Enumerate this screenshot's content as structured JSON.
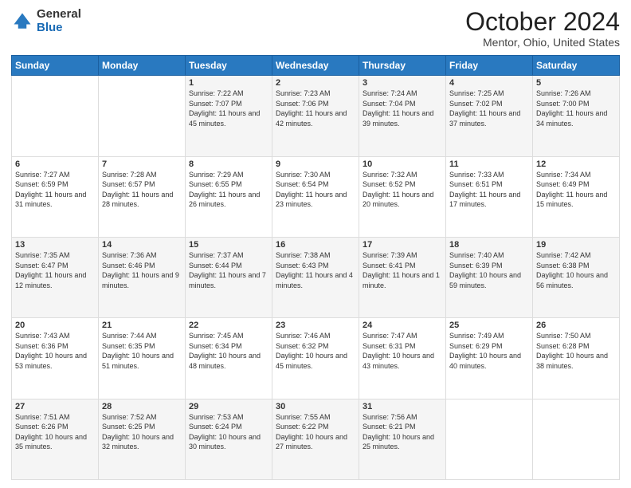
{
  "header": {
    "logo_general": "General",
    "logo_blue": "Blue",
    "title": "October 2024",
    "subtitle": "Mentor, Ohio, United States"
  },
  "weekdays": [
    "Sunday",
    "Monday",
    "Tuesday",
    "Wednesday",
    "Thursday",
    "Friday",
    "Saturday"
  ],
  "weeks": [
    [
      {
        "day": "",
        "sunrise": "",
        "sunset": "",
        "daylight": ""
      },
      {
        "day": "",
        "sunrise": "",
        "sunset": "",
        "daylight": ""
      },
      {
        "day": "1",
        "sunrise": "Sunrise: 7:22 AM",
        "sunset": "Sunset: 7:07 PM",
        "daylight": "Daylight: 11 hours and 45 minutes."
      },
      {
        "day": "2",
        "sunrise": "Sunrise: 7:23 AM",
        "sunset": "Sunset: 7:06 PM",
        "daylight": "Daylight: 11 hours and 42 minutes."
      },
      {
        "day": "3",
        "sunrise": "Sunrise: 7:24 AM",
        "sunset": "Sunset: 7:04 PM",
        "daylight": "Daylight: 11 hours and 39 minutes."
      },
      {
        "day": "4",
        "sunrise": "Sunrise: 7:25 AM",
        "sunset": "Sunset: 7:02 PM",
        "daylight": "Daylight: 11 hours and 37 minutes."
      },
      {
        "day": "5",
        "sunrise": "Sunrise: 7:26 AM",
        "sunset": "Sunset: 7:00 PM",
        "daylight": "Daylight: 11 hours and 34 minutes."
      }
    ],
    [
      {
        "day": "6",
        "sunrise": "Sunrise: 7:27 AM",
        "sunset": "Sunset: 6:59 PM",
        "daylight": "Daylight: 11 hours and 31 minutes."
      },
      {
        "day": "7",
        "sunrise": "Sunrise: 7:28 AM",
        "sunset": "Sunset: 6:57 PM",
        "daylight": "Daylight: 11 hours and 28 minutes."
      },
      {
        "day": "8",
        "sunrise": "Sunrise: 7:29 AM",
        "sunset": "Sunset: 6:55 PM",
        "daylight": "Daylight: 11 hours and 26 minutes."
      },
      {
        "day": "9",
        "sunrise": "Sunrise: 7:30 AM",
        "sunset": "Sunset: 6:54 PM",
        "daylight": "Daylight: 11 hours and 23 minutes."
      },
      {
        "day": "10",
        "sunrise": "Sunrise: 7:32 AM",
        "sunset": "Sunset: 6:52 PM",
        "daylight": "Daylight: 11 hours and 20 minutes."
      },
      {
        "day": "11",
        "sunrise": "Sunrise: 7:33 AM",
        "sunset": "Sunset: 6:51 PM",
        "daylight": "Daylight: 11 hours and 17 minutes."
      },
      {
        "day": "12",
        "sunrise": "Sunrise: 7:34 AM",
        "sunset": "Sunset: 6:49 PM",
        "daylight": "Daylight: 11 hours and 15 minutes."
      }
    ],
    [
      {
        "day": "13",
        "sunrise": "Sunrise: 7:35 AM",
        "sunset": "Sunset: 6:47 PM",
        "daylight": "Daylight: 11 hours and 12 minutes."
      },
      {
        "day": "14",
        "sunrise": "Sunrise: 7:36 AM",
        "sunset": "Sunset: 6:46 PM",
        "daylight": "Daylight: 11 hours and 9 minutes."
      },
      {
        "day": "15",
        "sunrise": "Sunrise: 7:37 AM",
        "sunset": "Sunset: 6:44 PM",
        "daylight": "Daylight: 11 hours and 7 minutes."
      },
      {
        "day": "16",
        "sunrise": "Sunrise: 7:38 AM",
        "sunset": "Sunset: 6:43 PM",
        "daylight": "Daylight: 11 hours and 4 minutes."
      },
      {
        "day": "17",
        "sunrise": "Sunrise: 7:39 AM",
        "sunset": "Sunset: 6:41 PM",
        "daylight": "Daylight: 11 hours and 1 minute."
      },
      {
        "day": "18",
        "sunrise": "Sunrise: 7:40 AM",
        "sunset": "Sunset: 6:39 PM",
        "daylight": "Daylight: 10 hours and 59 minutes."
      },
      {
        "day": "19",
        "sunrise": "Sunrise: 7:42 AM",
        "sunset": "Sunset: 6:38 PM",
        "daylight": "Daylight: 10 hours and 56 minutes."
      }
    ],
    [
      {
        "day": "20",
        "sunrise": "Sunrise: 7:43 AM",
        "sunset": "Sunset: 6:36 PM",
        "daylight": "Daylight: 10 hours and 53 minutes."
      },
      {
        "day": "21",
        "sunrise": "Sunrise: 7:44 AM",
        "sunset": "Sunset: 6:35 PM",
        "daylight": "Daylight: 10 hours and 51 minutes."
      },
      {
        "day": "22",
        "sunrise": "Sunrise: 7:45 AM",
        "sunset": "Sunset: 6:34 PM",
        "daylight": "Daylight: 10 hours and 48 minutes."
      },
      {
        "day": "23",
        "sunrise": "Sunrise: 7:46 AM",
        "sunset": "Sunset: 6:32 PM",
        "daylight": "Daylight: 10 hours and 45 minutes."
      },
      {
        "day": "24",
        "sunrise": "Sunrise: 7:47 AM",
        "sunset": "Sunset: 6:31 PM",
        "daylight": "Daylight: 10 hours and 43 minutes."
      },
      {
        "day": "25",
        "sunrise": "Sunrise: 7:49 AM",
        "sunset": "Sunset: 6:29 PM",
        "daylight": "Daylight: 10 hours and 40 minutes."
      },
      {
        "day": "26",
        "sunrise": "Sunrise: 7:50 AM",
        "sunset": "Sunset: 6:28 PM",
        "daylight": "Daylight: 10 hours and 38 minutes."
      }
    ],
    [
      {
        "day": "27",
        "sunrise": "Sunrise: 7:51 AM",
        "sunset": "Sunset: 6:26 PM",
        "daylight": "Daylight: 10 hours and 35 minutes."
      },
      {
        "day": "28",
        "sunrise": "Sunrise: 7:52 AM",
        "sunset": "Sunset: 6:25 PM",
        "daylight": "Daylight: 10 hours and 32 minutes."
      },
      {
        "day": "29",
        "sunrise": "Sunrise: 7:53 AM",
        "sunset": "Sunset: 6:24 PM",
        "daylight": "Daylight: 10 hours and 30 minutes."
      },
      {
        "day": "30",
        "sunrise": "Sunrise: 7:55 AM",
        "sunset": "Sunset: 6:22 PM",
        "daylight": "Daylight: 10 hours and 27 minutes."
      },
      {
        "day": "31",
        "sunrise": "Sunrise: 7:56 AM",
        "sunset": "Sunset: 6:21 PM",
        "daylight": "Daylight: 10 hours and 25 minutes."
      },
      {
        "day": "",
        "sunrise": "",
        "sunset": "",
        "daylight": ""
      },
      {
        "day": "",
        "sunrise": "",
        "sunset": "",
        "daylight": ""
      }
    ]
  ]
}
